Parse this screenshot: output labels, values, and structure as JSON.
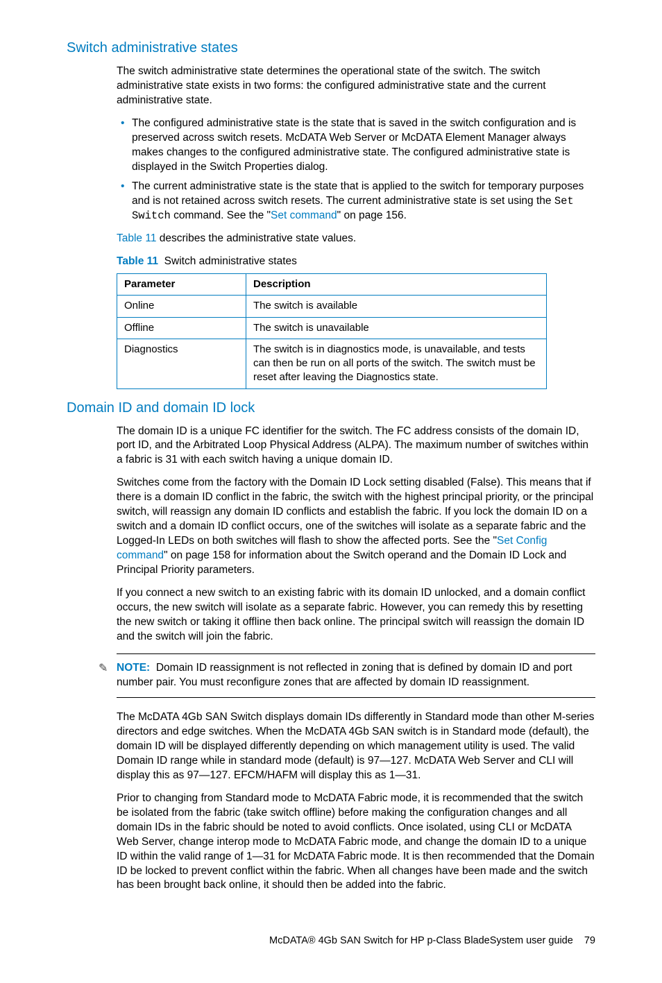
{
  "sec1": {
    "heading": "Switch administrative states",
    "p1": "The switch administrative state determines the operational state of the switch. The switch administrative state exists in two forms: the configured administrative state and the current administrative state.",
    "li1": "The configured administrative state is the state that is saved in the switch configuration and is preserved across switch resets. McDATA Web Server or McDATA Element Manager always makes changes to the configured administrative state. The configured administrative state is displayed in the Switch Properties dialog.",
    "li2a": "The current administrative state is the state that is applied to the switch for temporary purposes and is not retained across switch resets. The current administrative state is set using the ",
    "li2cmd": "Set Switch",
    "li2b": " command. See the \"",
    "li2link": "Set command",
    "li2c": "\" on page 156.",
    "p2a": "",
    "p2link": "Table 11",
    "p2b": " describes the administrative state values.",
    "table_caption_label": "Table 11",
    "table_caption_text": "Switch administrative states",
    "th1": "Parameter",
    "th2": "Description",
    "r1c1": "Online",
    "r1c2": "The switch is available",
    "r2c1": "Offline",
    "r2c2": "The switch is unavailable",
    "r3c1": "Diagnostics",
    "r3c2": "The switch is in diagnostics mode, is unavailable, and tests can then be run on all ports of the switch. The switch must be reset after leaving the Diagnostics state."
  },
  "sec2": {
    "heading": "Domain ID and domain ID lock",
    "p1": "The domain ID is a unique FC identifier for the switch. The FC address consists of the domain ID, port ID, and the Arbitrated Loop Physical Address (ALPA). The maximum number of switches within a fabric is 31 with each switch having a unique domain ID.",
    "p2a": "Switches come from the factory with the Domain ID Lock setting disabled (False). This means that if there is a domain ID conflict in the fabric, the switch with the highest principal priority, or the principal switch, will reassign any domain ID conflicts and establish the fabric. If you lock the domain ID on a switch and a domain ID conflict occurs, one of the switches will isolate as a separate fabric and the Logged-In LEDs on both switches will flash to show the affected ports. See the \"",
    "p2link": "Set Config command",
    "p2b": "\" on page 158 for information about the Switch operand and the Domain ID Lock and Principal Priority parameters.",
    "p3": "If you connect a new switch to an existing fabric with its domain ID unlocked, and a domain conflict occurs, the new switch will isolate as a separate fabric. However, you can remedy this by resetting the new switch or taking it offline then back online. The principal switch will reassign the domain ID and the switch will join the fabric.",
    "note_label": "NOTE:",
    "note_text": "Domain ID reassignment is not reflected in zoning that is defined by domain ID and port number pair. You must reconfigure zones that are affected by domain ID reassignment.",
    "p4": "The McDATA 4Gb SAN Switch displays domain IDs differently in Standard mode than other M-series directors and edge switches. When the McDATA 4Gb SAN switch is in Standard mode (default), the domain ID will be displayed differently depending on which management utility is used. The valid Domain ID range while in standard mode (default) is 97—127. McDATA Web Server and CLI will display this as 97—127. EFCM/HAFM will display this as 1—31.",
    "p5": "Prior to changing from Standard mode to McDATA Fabric mode, it is recommended that the switch be isolated from the fabric (take switch offline) before making the configuration changes and all domain IDs in the fabric should be noted to avoid conflicts. Once isolated, using CLI or McDATA Web Server, change interop mode to McDATA Fabric mode, and change the domain ID to a unique ID within the valid range of 1—31 for McDATA Fabric mode. It is then recommended that the Domain ID be locked to prevent conflict within the fabric. When all changes have been made and the switch has been brought back online, it should then be added into the fabric."
  },
  "footer": {
    "title": "McDATA® 4Gb SAN Switch for HP p-Class BladeSystem user guide",
    "page": "79"
  }
}
